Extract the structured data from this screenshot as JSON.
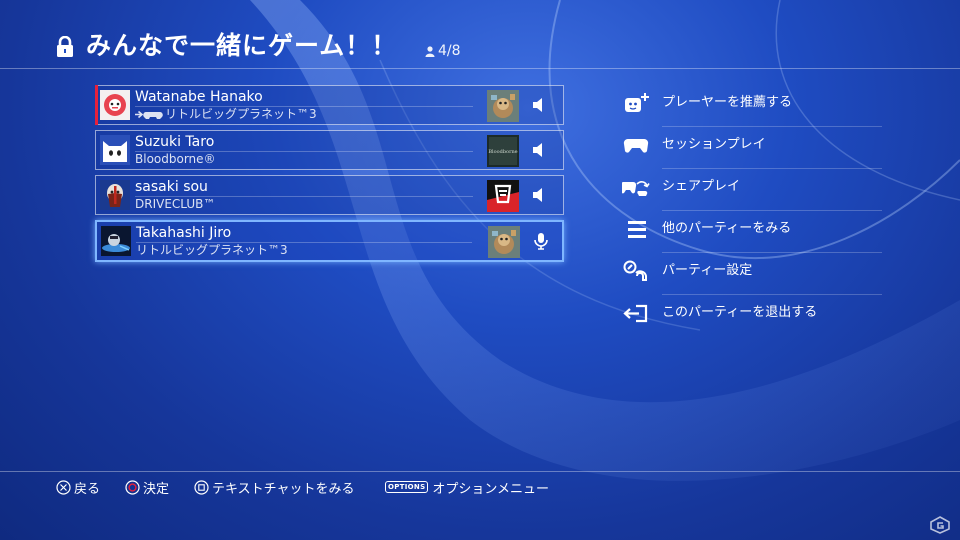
{
  "header": {
    "title": "みんなで一緒にゲーム！！",
    "member_count": "4/8",
    "icons": {
      "lock": "lock-icon",
      "members": "person-icon"
    }
  },
  "members": [
    {
      "name": "Watanabe Hanako",
      "game": "リトルビッグプラネット™3",
      "game_prefix_icon": "arrow-controller-icon",
      "voice": "speaker-icon",
      "selected": false
    },
    {
      "name": "Suzuki Taro",
      "game": "Bloodborne®",
      "thumb_text": "Bloodborne",
      "voice": "speaker-icon",
      "selected": false
    },
    {
      "name": "sasaki sou",
      "game": "DRIVECLUB™",
      "voice": "speaker-icon",
      "selected": false
    },
    {
      "name": "Takahashi Jiro",
      "game": "リトルビッグプラネット™3",
      "voice": "microphone-icon",
      "selected": true
    }
  ],
  "menu": [
    {
      "label": "プレーヤーを推薦する",
      "icon": "recommend-player-icon"
    },
    {
      "label": "セッションプレイ",
      "icon": "controller-icon"
    },
    {
      "label": "シェアプレイ",
      "icon": "share-play-icon"
    },
    {
      "label": "他のパーティーをみる",
      "icon": "list-icon"
    },
    {
      "label": "パーティー設定",
      "icon": "party-settings-icon"
    },
    {
      "label": "このパーティーを退出する",
      "icon": "leave-icon"
    }
  ],
  "footer": {
    "back": "戻る",
    "confirm": "決定",
    "text_chat": "テキストチャットをみる",
    "options_badge": "OPTIONS",
    "options": "オプションメニュー"
  },
  "colors": {
    "background": "#1f4cc2",
    "selection_border": "#7fb6ff",
    "active_marker": "#e5213c"
  }
}
